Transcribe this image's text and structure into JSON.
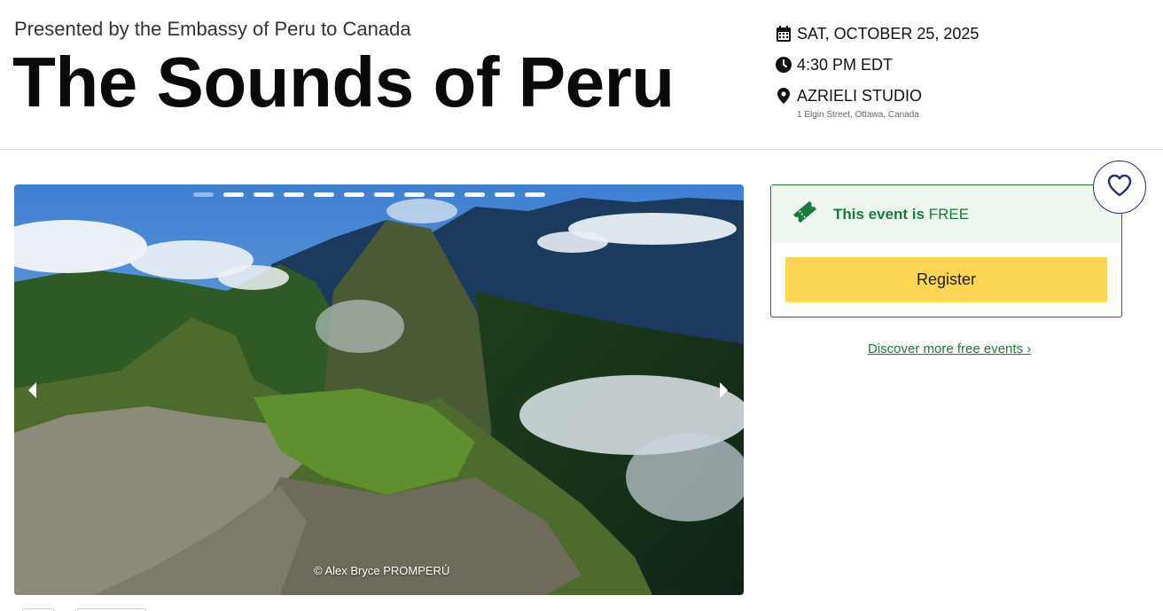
{
  "header": {
    "presenter": "Presented by the Embassy of Peru to Canada",
    "title": "The Sounds of Peru"
  },
  "event_meta": {
    "date": "SAT, OCTOBER 25, 2025",
    "time": "4:30 PM EDT",
    "venue": "AZRIELI STUDIO",
    "address": "1 Elgin Street, Ottawa, Canada",
    "icons": [
      "calendar-icon",
      "clock-icon",
      "map-pin-icon"
    ]
  },
  "carousel": {
    "slide_count": 12,
    "active_index": 0,
    "photo_credit": "© Alex Bryce PROMPERÚ",
    "prev_icon": "chevron-left-icon",
    "next_icon": "chevron-right-icon"
  },
  "ticket": {
    "price_prefix": "This event is ",
    "price_value": "FREE",
    "register_label": "Register",
    "icon": "ticket-icon"
  },
  "discover_link": "Discover more free events ›",
  "favorite": {
    "icon": "heart-icon"
  },
  "colors": {
    "accent_green": "#1c7a3c",
    "register_yellow": "#fcd553",
    "heart_navy": "#2a2d6e"
  }
}
